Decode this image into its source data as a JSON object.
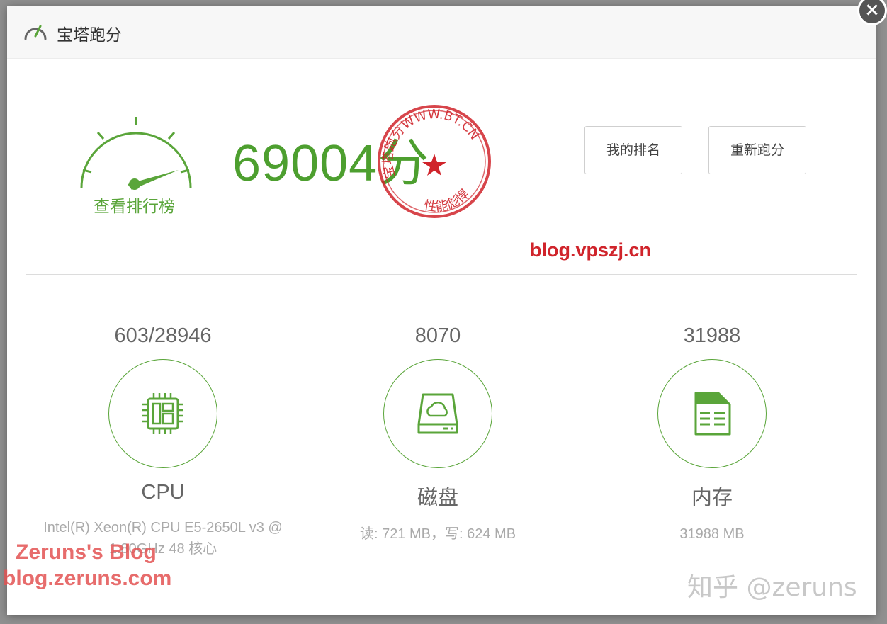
{
  "dialog": {
    "title": "宝塔跑分",
    "close_label": "×"
  },
  "gauge": {
    "link_label": "查看排行榜"
  },
  "score": {
    "value": "69004",
    "unit": "分"
  },
  "stamp": {
    "top_text": "宝塔跑分WWW.BT.CN",
    "bottom_text": "性能彪悍"
  },
  "buttons": {
    "my_rank": "我的排名",
    "rerun": "重新跑分"
  },
  "metrics": [
    {
      "score": "603/28946",
      "icon": "cpu-chip-icon",
      "label": "CPU",
      "detail": "Intel(R) Xeon(R) CPU E5-2650L v3 @ 1.80GHz 48 核心"
    },
    {
      "score": "8070",
      "icon": "disk-drive-icon",
      "label": "磁盘",
      "detail": "读: 721 MB，写: 624 MB"
    },
    {
      "score": "31988",
      "icon": "memory-icon",
      "label": "内存",
      "detail": "31988 MB"
    }
  ],
  "watermarks": {
    "center": "blog.vpszj.cn",
    "zeruns_line1": "Zeruns's Blog",
    "zeruns_line2": "blog.zeruns.com",
    "zhihu": "知乎 @zeruns"
  },
  "colors": {
    "accent_green": "#4d9f2f",
    "stamp_red": "#d0242b"
  }
}
